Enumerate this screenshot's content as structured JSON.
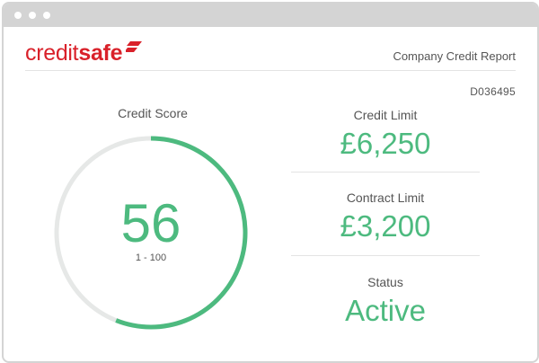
{
  "window": {
    "titlebar_dots": 3
  },
  "brand": {
    "logo_text_regular": "credit",
    "logo_text_bold": "safe",
    "color": "#d9212a"
  },
  "header": {
    "report_title": "Company Credit Report",
    "reference": "D036495"
  },
  "credit_score": {
    "label": "Credit Score",
    "value": "56",
    "range": "1 - 100",
    "score_fraction": 0.56,
    "gauge_color": "#4dba7f",
    "track_color": "#e6e8e7"
  },
  "stats": [
    {
      "label": "Credit Limit",
      "value": "£6,250"
    },
    {
      "label": "Contract Limit",
      "value": "£3,200"
    },
    {
      "label": "Status",
      "value": "Active"
    }
  ],
  "accent_color": "#4dba7f"
}
